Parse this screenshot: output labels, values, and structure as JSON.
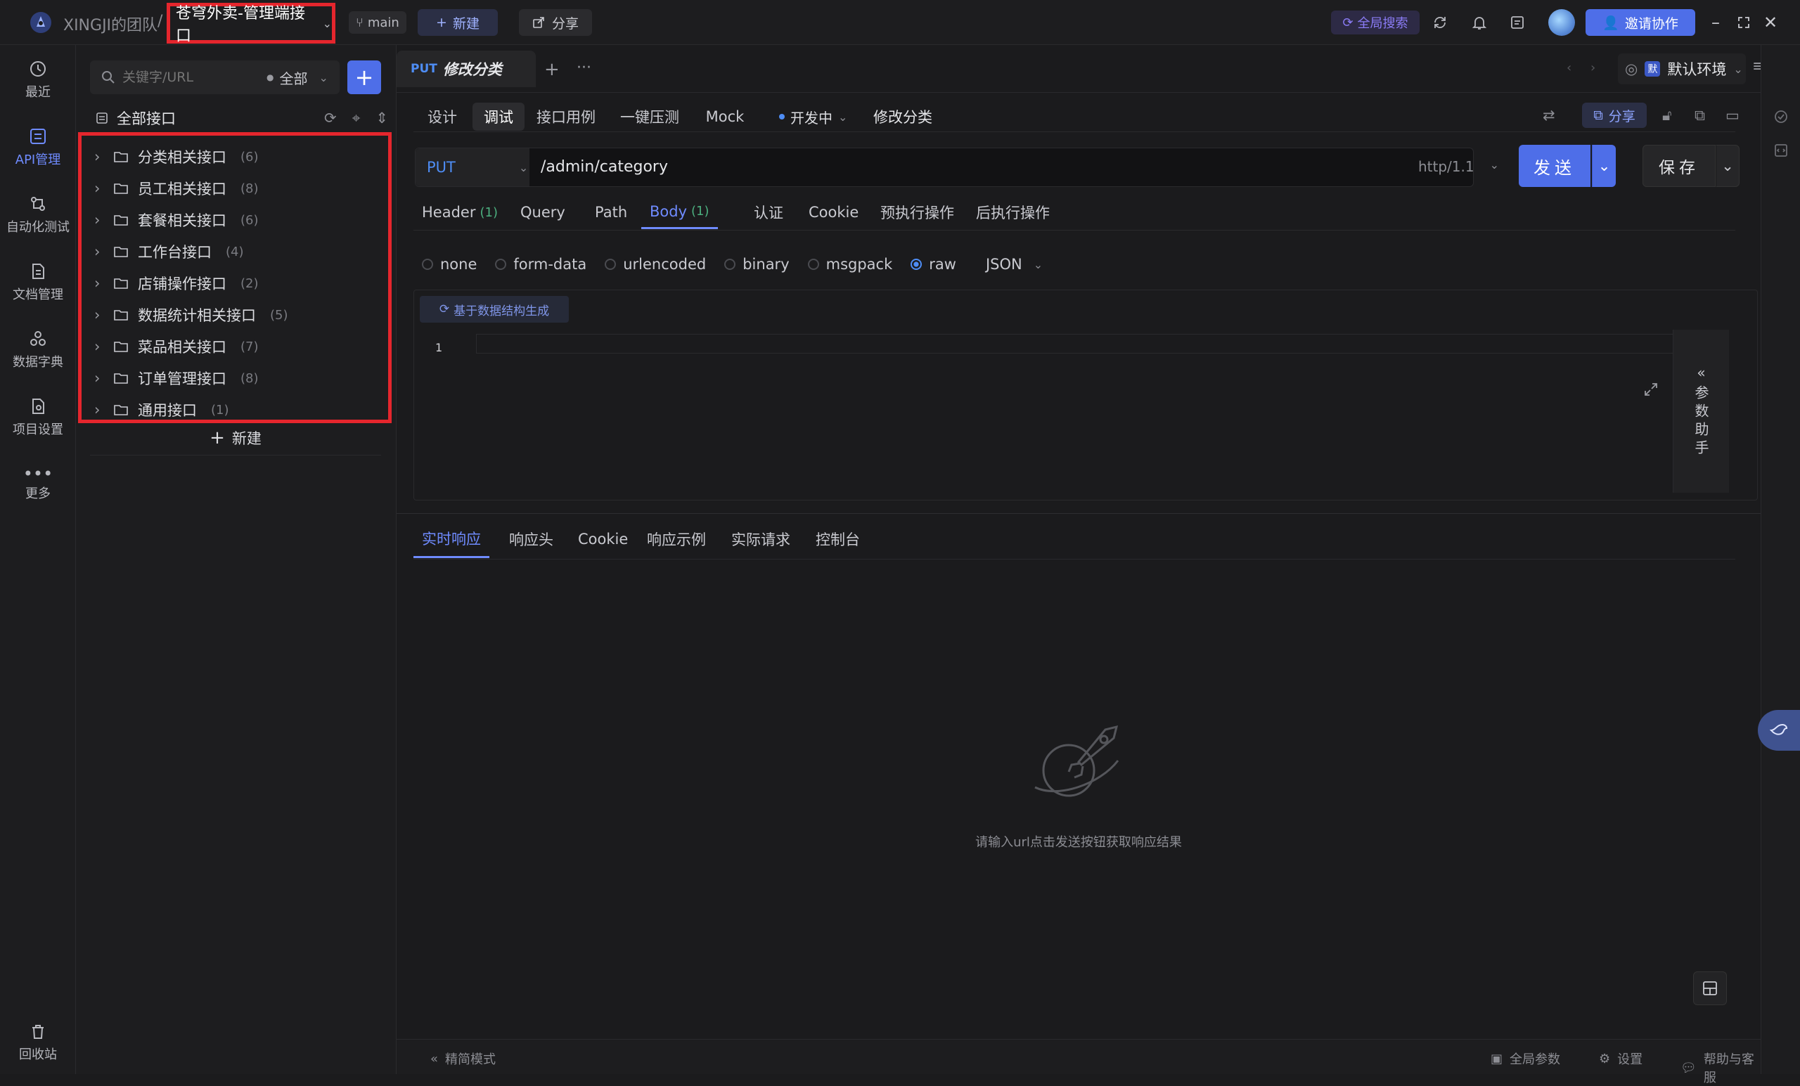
{
  "titlebar": {
    "team": "XINGJI的团队",
    "separator": "/",
    "project": "苍穹外卖-管理端接口",
    "branch": "main",
    "new_label": "新建",
    "share_label": "分享",
    "search_label": "全局搜索",
    "invite_label": "邀请协作"
  },
  "rail": {
    "items": [
      {
        "label": "最近",
        "icon": "clock-icon"
      },
      {
        "label": "API管理",
        "icon": "api-icon"
      },
      {
        "label": "自动化测试",
        "icon": "automation-icon"
      },
      {
        "label": "文档管理",
        "icon": "document-icon"
      },
      {
        "label": "数据字典",
        "icon": "dictionary-icon"
      },
      {
        "label": "项目设置",
        "icon": "project-settings-icon"
      },
      {
        "label": "更多",
        "icon": "more-icon"
      }
    ],
    "trash_label": "回收站"
  },
  "sidebar": {
    "search_placeholder": "关键字/URL",
    "filter_label": "全部",
    "header": "全部接口",
    "folders": [
      {
        "name": "分类相关接口",
        "count": "(6)"
      },
      {
        "name": "员工相关接口",
        "count": "(8)"
      },
      {
        "name": "套餐相关接口",
        "count": "(6)"
      },
      {
        "name": "工作台接口",
        "count": "(4)"
      },
      {
        "name": "店铺操作接口",
        "count": "(2)"
      },
      {
        "name": "数据统计相关接口",
        "count": "(5)"
      },
      {
        "name": "菜品相关接口",
        "count": "(7)"
      },
      {
        "name": "订单管理接口",
        "count": "(8)"
      },
      {
        "name": "通用接口",
        "count": "(1)"
      }
    ],
    "new_label": "新建"
  },
  "main": {
    "tab": {
      "method": "PUT",
      "title": "修改分类"
    },
    "environment": {
      "badge": "默",
      "label": "默认环境"
    },
    "subtabs": [
      "设计",
      "调试",
      "接口用例",
      "一键压测",
      "Mock"
    ],
    "status": "开发中",
    "api_name": "修改分类",
    "share_label": "分享",
    "request": {
      "method": "PUT",
      "url": "/admin/category",
      "protocol": "http/1.1",
      "send_label": "发送",
      "save_label": "保存"
    },
    "request_tabs": [
      {
        "label": "Header",
        "count": "(1)"
      },
      {
        "label": "Query",
        "count": ""
      },
      {
        "label": "Path",
        "count": ""
      },
      {
        "label": "Body",
        "count": "(1)"
      },
      {
        "label": "认证",
        "count": ""
      },
      {
        "label": "Cookie",
        "count": ""
      },
      {
        "label": "预执行操作",
        "count": ""
      },
      {
        "label": "后执行操作",
        "count": ""
      }
    ],
    "body_types": [
      "none",
      "form-data",
      "urlencoded",
      "binary",
      "msgpack",
      "raw"
    ],
    "body_selected": "raw",
    "body_format": "JSON",
    "generate_label": "基于数据结构生成",
    "line_number": "1",
    "assistant_label": "参数助手",
    "response_tabs": [
      "实时响应",
      "响应头",
      "Cookie",
      "响应示例",
      "实际请求",
      "控制台"
    ],
    "empty_text": "请输入url点击发送按钮获取响应结果",
    "footer": {
      "compact_mode": "精简模式",
      "global_params": "全局参数",
      "settings": "设置",
      "help": "帮助与客服"
    }
  },
  "colors": {
    "accent": "#4e6ee8",
    "highlight_box": "#e5262d",
    "method_put": "#4e8df5",
    "count_green": "#4caf7f"
  }
}
